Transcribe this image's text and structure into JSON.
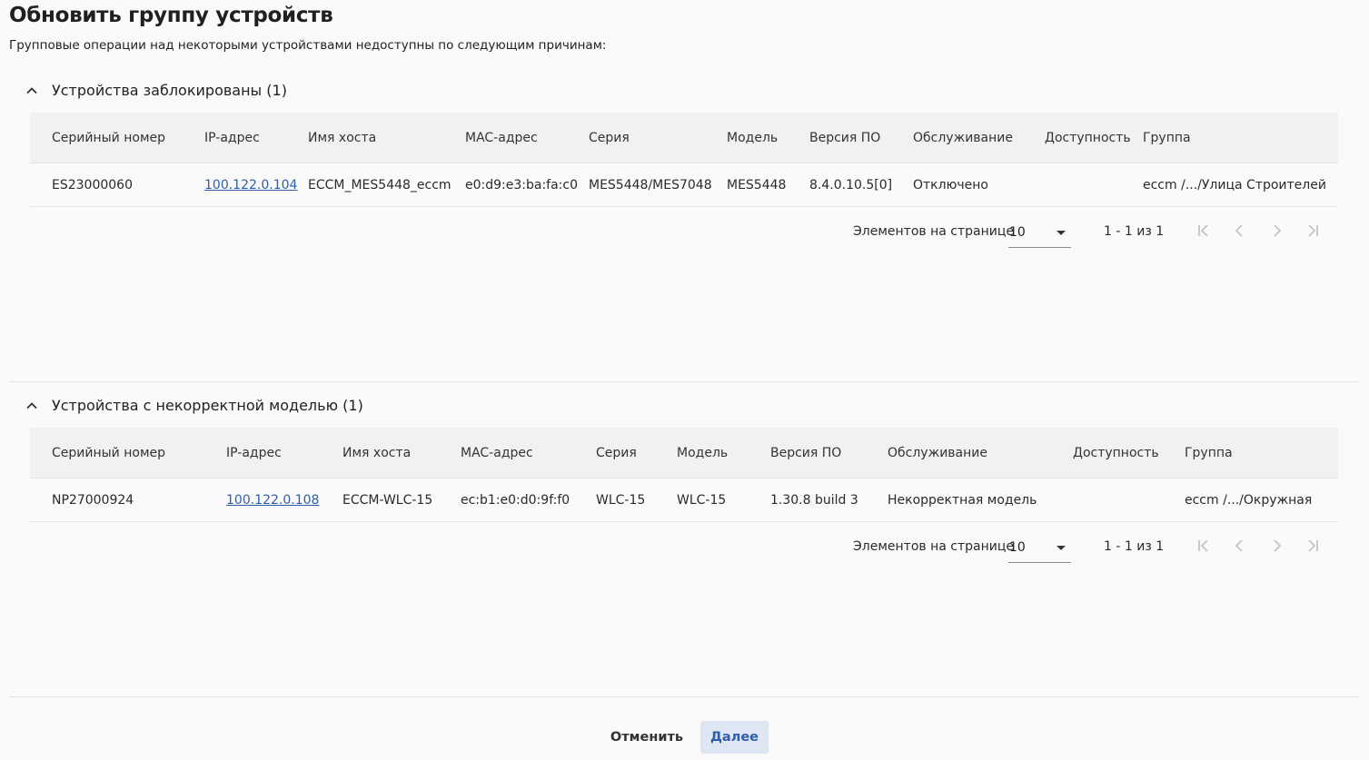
{
  "page": {
    "title": "Обновить группу устройств",
    "subtitle": "Групповые операции над некоторыми устройствами недоступны по следующим причинам:"
  },
  "sections": [
    {
      "title": "Устройства заблокированы (1)",
      "columns": [
        "Серийный номер",
        "IP-адрес",
        "Имя хоста",
        "MAC-адрес",
        "Серия",
        "Модель",
        "Версия ПО",
        "Обслуживание",
        "Доступность",
        "Группа"
      ],
      "rows": [
        [
          "ES23000060",
          "100.122.0.104",
          "ECCM_MES5448_eccm",
          "e0:d9:e3:ba:fa:c0",
          "MES5448/MES7048",
          "MES5448",
          "8.4.0.10.5[0]",
          "Отключено",
          "",
          "eccm /.../Улица Строителей"
        ]
      ],
      "pager": {
        "label": "Элементов на странице",
        "page_size": "10",
        "range": "1 - 1 из 1"
      }
    },
    {
      "title": "Устройства с некорректной моделью (1)",
      "columns": [
        "Серийный номер",
        "IP-адрес",
        "Имя хоста",
        "MAC-адрес",
        "Серия",
        "Модель",
        "Версия ПО",
        "Обслуживание",
        "Доступность",
        "Группа"
      ],
      "rows": [
        [
          "NP27000924",
          "100.122.0.108",
          "ECCM-WLC-15",
          "ec:b1:e0:d0:9f:f0",
          "WLC-15",
          "WLC-15",
          "1.30.8 build 3",
          "Некорректная модель",
          "",
          "eccm /.../Окружная"
        ]
      ],
      "pager": {
        "label": "Элементов на странице",
        "page_size": "10",
        "range": "1 - 1 из 1"
      }
    }
  ],
  "footer": {
    "cancel_label": "Отменить",
    "next_label": "Далее"
  },
  "colors": {
    "link": "#2f5ea8",
    "primary_button_bg": "#dde6f2",
    "header_bg": "#f1f1f1"
  },
  "icons": [
    "chevron-up-icon",
    "first-page-icon",
    "prev-page-icon",
    "next-page-icon",
    "last-page-icon",
    "dropdown-arrow-icon"
  ]
}
